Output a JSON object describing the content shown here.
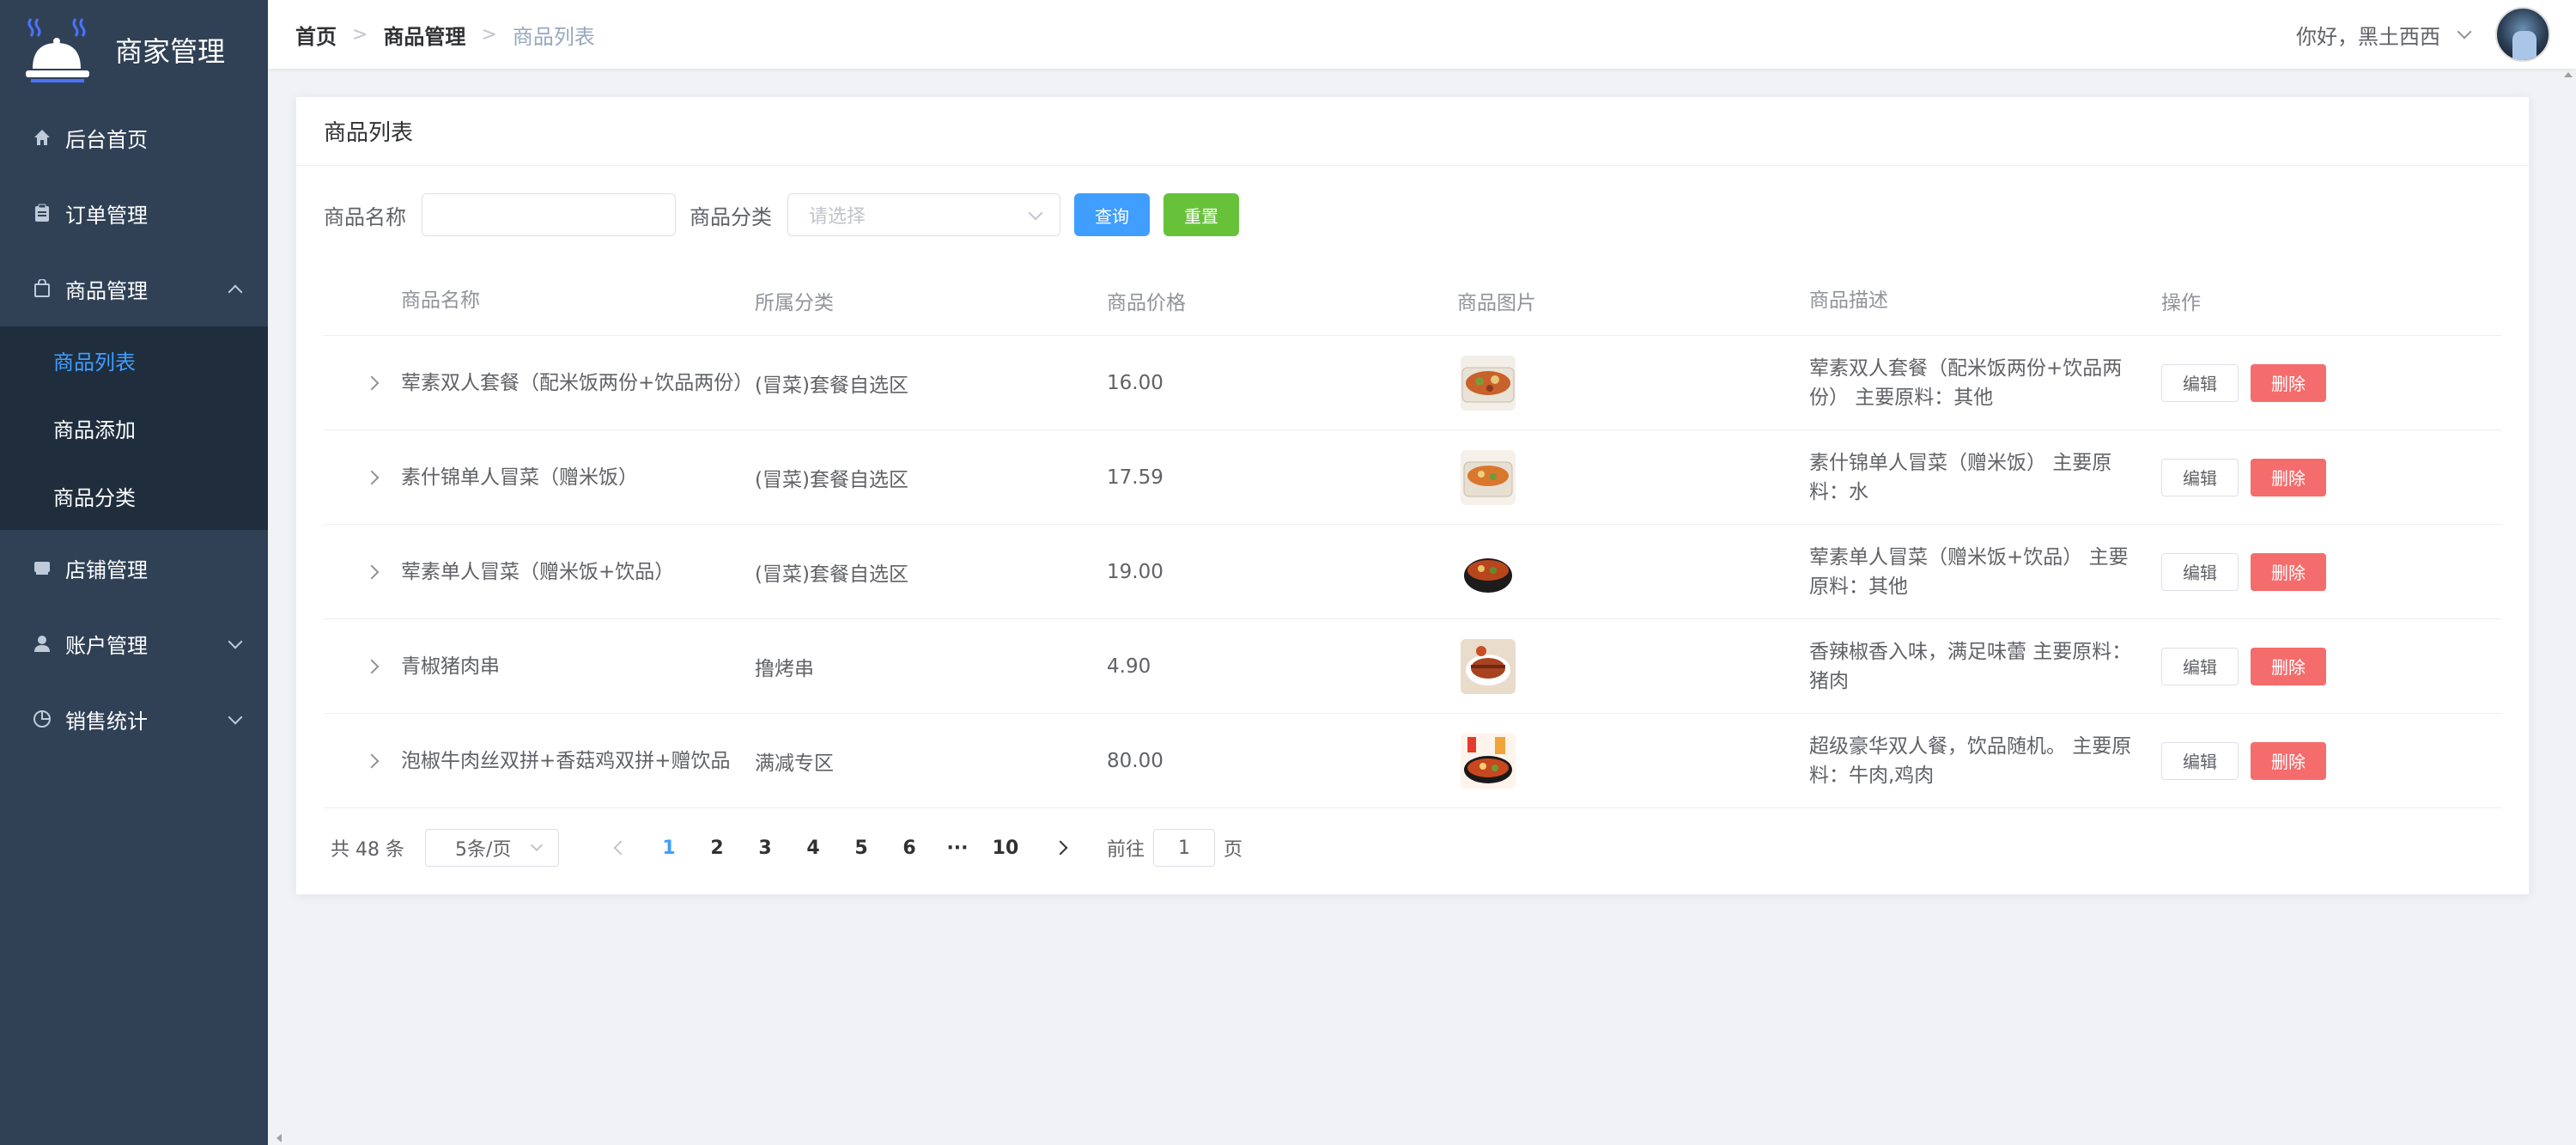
{
  "app": {
    "title": "商家管理"
  },
  "sidebar": {
    "items": [
      {
        "label": "后台首页",
        "icon": "home-icon"
      },
      {
        "label": "订单管理",
        "icon": "clipboard-icon"
      },
      {
        "label": "商品管理",
        "icon": "bag-icon",
        "expanded": true,
        "children": [
          "商品列表",
          "商品添加",
          "商品分类"
        ],
        "active_child": "商品列表"
      },
      {
        "label": "店铺管理",
        "icon": "shop-icon"
      },
      {
        "label": "账户管理",
        "icon": "user-icon",
        "expanded": false
      },
      {
        "label": "销售统计",
        "icon": "pie-chart-icon",
        "expanded": false
      }
    ]
  },
  "breadcrumb": [
    "首页",
    "商品管理",
    "商品列表"
  ],
  "user": {
    "greeting": "你好，黑土西西"
  },
  "card": {
    "title": "商品列表"
  },
  "filter": {
    "name_label": "商品名称",
    "name_value": "",
    "category_label": "商品分类",
    "category_placeholder": "请选择",
    "search_button": "查询",
    "reset_button": "重置"
  },
  "table": {
    "headers": [
      "商品名称",
      "所属分类",
      "商品价格",
      "商品图片",
      "商品描述",
      "操作"
    ],
    "edit_label": "编辑",
    "delete_label": "删除",
    "rows": [
      {
        "name": "荤素双人套餐（配米饭两份+饮品两份）",
        "category": "(冒菜)套餐自选区",
        "price": "16.00",
        "image": "food-photo-1",
        "desc": "荤素双人套餐（配米饭两份+饮品两份） 主要原料：其他"
      },
      {
        "name": "素什锦单人冒菜（赠米饭）",
        "category": "(冒菜)套餐自选区",
        "price": "17.59",
        "image": "food-photo-2",
        "desc": "素什锦单人冒菜（赠米饭） 主要原料：水"
      },
      {
        "name": "荤素单人冒菜（赠米饭+饮品）",
        "category": "(冒菜)套餐自选区",
        "price": "19.00",
        "image": "food-photo-3",
        "desc": "荤素单人冒菜（赠米饭+饮品） 主要原料：其他"
      },
      {
        "name": "青椒猪肉串",
        "category": "撸烤串",
        "price": "4.90",
        "image": "food-photo-4",
        "desc": "香辣椒香入味，满足味蕾 主要原料：猪肉"
      },
      {
        "name": "泡椒牛肉丝双拼+香菇鸡双拼+赠饮品",
        "category": "满减专区",
        "price": "80.00",
        "image": "food-photo-5",
        "desc": "超级豪华双人餐，饮品随机。 主要原料：牛肉,鸡肉"
      }
    ]
  },
  "pagination": {
    "total_text": "共 48 条",
    "page_size": "5条/页",
    "pages": [
      "1",
      "2",
      "3",
      "4",
      "5",
      "6",
      "···",
      "10"
    ],
    "current": "1",
    "goto_prefix": "前往",
    "goto_value": "1",
    "goto_suffix": "页"
  },
  "colors": {
    "sidebar": "#304156",
    "submenu": "#1f2d3d",
    "primary": "#409eff",
    "success": "#67c23a",
    "danger": "#f56c6c"
  }
}
